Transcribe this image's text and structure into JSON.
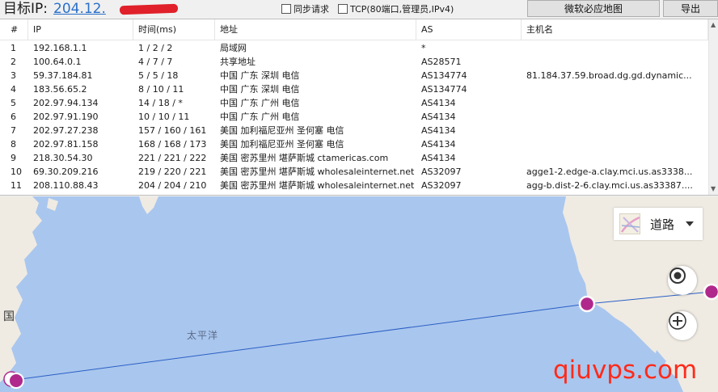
{
  "header": {
    "target_label": "目标IP:",
    "target_ip": "204.12.",
    "sync_request_label": "同步请求",
    "tcp_label": "TCP(80端口,管理员,IPv4)",
    "bing_map_button": "微软必应地图",
    "export_button": "导出"
  },
  "table": {
    "columns": [
      "#",
      "IP",
      "时间(ms)",
      "地址",
      "AS",
      "主机名"
    ],
    "rows": [
      {
        "n": "1",
        "ip": "192.168.1.1",
        "time": "1 / 2 / 2",
        "addr": "局域网",
        "as": "*",
        "host": ""
      },
      {
        "n": "2",
        "ip": "100.64.0.1",
        "time": "4 / 7 / 7",
        "addr": "共享地址",
        "as": "AS28571",
        "host": ""
      },
      {
        "n": "3",
        "ip": "59.37.184.81",
        "time": "5 / 5 / 18",
        "addr": "中国 广东 深圳 电信",
        "as": "AS134774",
        "host": "81.184.37.59.broad.dg.gd.dynamic..."
      },
      {
        "n": "4",
        "ip": "183.56.65.2",
        "time": "8 / 10 / 11",
        "addr": "中国 广东 深圳 电信",
        "as": "AS134774",
        "host": ""
      },
      {
        "n": "5",
        "ip": "202.97.94.134",
        "time": "14 / 18 / *",
        "addr": "中国 广东 广州 电信",
        "as": "AS4134",
        "host": ""
      },
      {
        "n": "6",
        "ip": "202.97.91.190",
        "time": "10 / 10 / 11",
        "addr": "中国 广东 广州 电信",
        "as": "AS4134",
        "host": ""
      },
      {
        "n": "7",
        "ip": "202.97.27.238",
        "time": "157 / 160 / 161",
        "addr": "美国 加利福尼亚州 圣何塞 电信",
        "as": "AS4134",
        "host": ""
      },
      {
        "n": "8",
        "ip": "202.97.81.158",
        "time": "168 / 168 / 173",
        "addr": "美国 加利福尼亚州 圣何塞 电信",
        "as": "AS4134",
        "host": ""
      },
      {
        "n": "9",
        "ip": "218.30.54.30",
        "time": "221 / 221 / 222",
        "addr": "美国 密苏里州 堪萨斯城 ctamericas.com",
        "as": "AS4134",
        "host": ""
      },
      {
        "n": "10",
        "ip": "69.30.209.216",
        "time": "219 / 220 / 221",
        "addr": "美国 密苏里州 堪萨斯城 wholesaleinternet.net",
        "as": "AS32097",
        "host": "agge1-2.edge-a.clay.mci.us.as3338..."
      },
      {
        "n": "11",
        "ip": "208.110.88.43",
        "time": "204 / 204 / 210",
        "addr": "美国 密苏里州 堪萨斯城 wholesaleinternet.net",
        "as": "AS32097",
        "host": "agg-b.dist-2-6.clay.mci.us.as33387...."
      }
    ]
  },
  "map": {
    "ocean_label": "太平洋",
    "country_label": "国",
    "road_mode_label": "道路",
    "watermark": "qiuvps.com"
  },
  "colors": {
    "ocean": "#a9c6ee",
    "land": "#efebe3",
    "route_line": "#2a5fc4",
    "hop_marker": "#b0288c",
    "link": "#2a6fc9"
  },
  "icons": {
    "locate": "locate-icon",
    "zoom_in": "plus-icon",
    "road_map": "road-map-icon",
    "dropdown": "caret-down-icon"
  }
}
